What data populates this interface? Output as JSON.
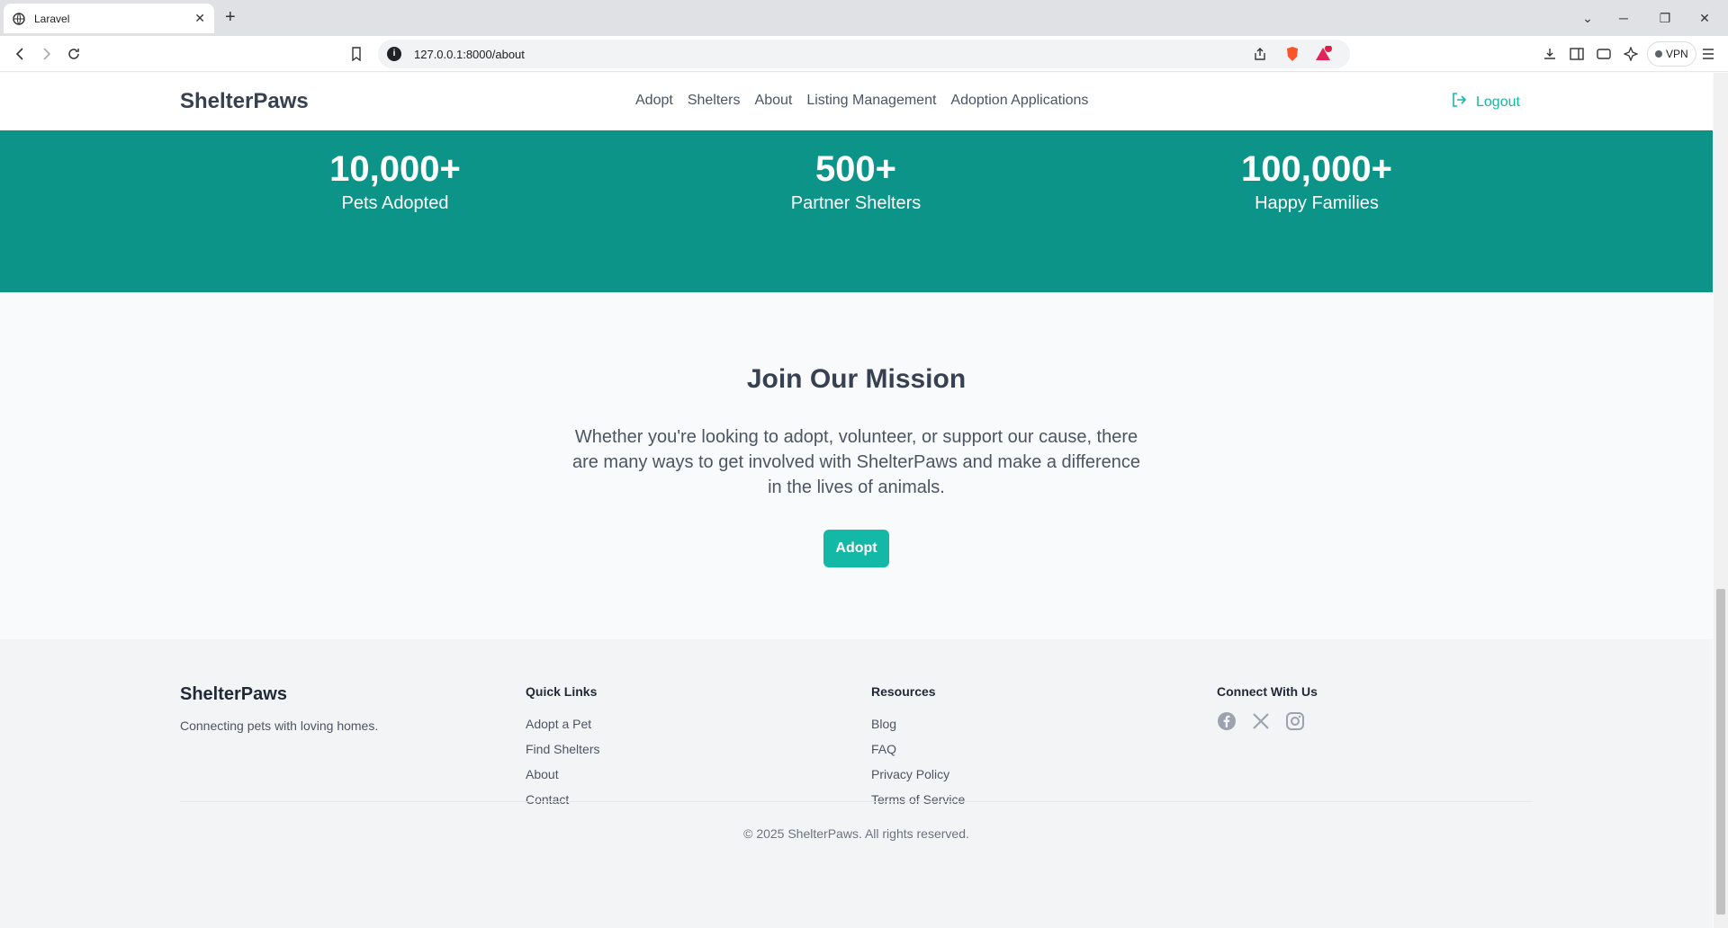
{
  "browser": {
    "tab_title": "Laravel",
    "url": "127.0.0.1:8000/about",
    "vpn_label": "VPN",
    "notification_count": "1"
  },
  "header": {
    "brand": "ShelterPaws",
    "nav": [
      "Adopt",
      "Shelters",
      "About",
      "Listing Management",
      "Adoption Applications"
    ],
    "logout": "Logout"
  },
  "stats": [
    {
      "value": "10,000+",
      "label": "Pets Adopted"
    },
    {
      "value": "500+",
      "label": "Partner Shelters"
    },
    {
      "value": "100,000+",
      "label": "Happy Families"
    }
  ],
  "mission": {
    "title": "Join Our Mission",
    "text": "Whether you're looking to adopt, volunteer, or support our cause, there are many ways to get involved with ShelterPaws and make a difference in the lives of animals.",
    "button": "Adopt"
  },
  "footer": {
    "brand": "ShelterPaws",
    "tagline": "Connecting pets with loving homes.",
    "quick_links": {
      "title": "Quick Links",
      "items": [
        "Adopt a Pet",
        "Find Shelters",
        "About",
        "Contact"
      ]
    },
    "resources": {
      "title": "Resources",
      "items": [
        "Blog",
        "FAQ",
        "Privacy Policy",
        "Terms of Service"
      ]
    },
    "connect": {
      "title": "Connect With Us",
      "icons": [
        "facebook-icon",
        "x-icon",
        "instagram-icon"
      ]
    },
    "copyright": "© 2025 ShelterPaws. All rights reserved."
  },
  "colors": {
    "accent": "#14b8a6",
    "stats_bg": "#0d9488",
    "text": "#374151"
  }
}
